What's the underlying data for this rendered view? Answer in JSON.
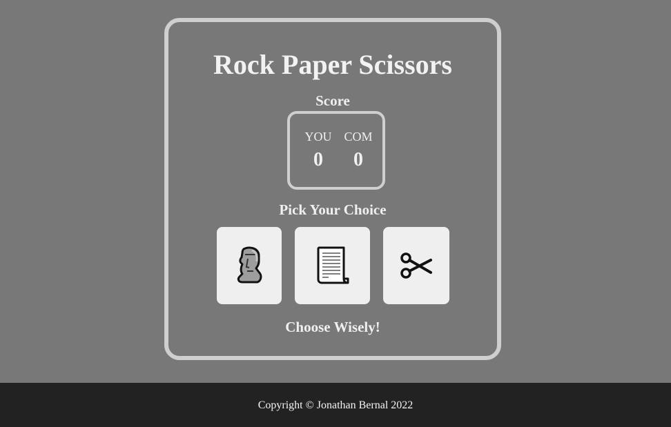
{
  "game": {
    "title": "Rock Paper Scissors",
    "score_label": "Score",
    "player_label": "YOU",
    "computer_label": "COM",
    "player_score": "0",
    "computer_score": "0",
    "pick_label": "Pick Your Choice",
    "result_text": "Choose Wisely!",
    "choices": [
      {
        "id": "rock",
        "icon": "moai-icon"
      },
      {
        "id": "paper",
        "icon": "page-icon"
      },
      {
        "id": "scissors",
        "icon": "scissors-icon"
      }
    ]
  },
  "footer": {
    "copyright": "Copyright © Jonathan Bernal 2022"
  },
  "colors": {
    "background": "#787878",
    "card_border": "#cfcfcf",
    "choice_bg": "#efefef",
    "footer_bg": "#222222",
    "text": "#f0f0f0"
  }
}
